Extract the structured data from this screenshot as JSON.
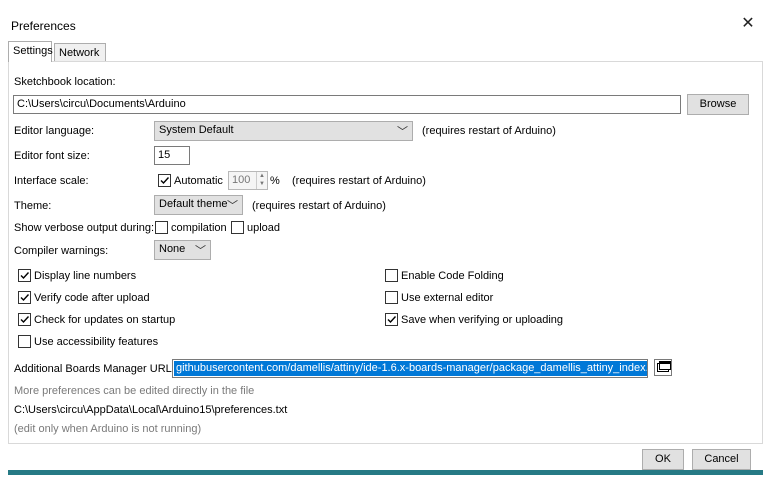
{
  "window": {
    "title": "Preferences",
    "close_icon": "close-icon"
  },
  "tabs": [
    {
      "label": "Settings",
      "active": true
    },
    {
      "label": "Network",
      "active": false
    }
  ],
  "sketchbook": {
    "label": "Sketchbook location:",
    "value": "C:\\Users\\circu\\Documents\\Arduino",
    "browse": "Browse"
  },
  "editor_language": {
    "label": "Editor language:",
    "value": "System Default",
    "note": "(requires restart of Arduino)"
  },
  "font_size": {
    "label": "Editor font size:",
    "value": "15"
  },
  "interface_scale": {
    "label": "Interface scale:",
    "automatic_label": "Automatic",
    "automatic_checked": true,
    "value": "100",
    "unit": "%",
    "note": "(requires restart of Arduino)"
  },
  "theme": {
    "label": "Theme:",
    "value": "Default theme",
    "note": "(requires restart of Arduino)"
  },
  "verbose": {
    "label": "Show verbose output during:",
    "compilation": "compilation",
    "compilation_checked": false,
    "upload": "upload",
    "upload_checked": false
  },
  "compiler_warnings": {
    "label": "Compiler warnings:",
    "value": "None"
  },
  "options_left": [
    {
      "label": "Display line numbers",
      "checked": true
    },
    {
      "label": "Verify code after upload",
      "checked": true
    },
    {
      "label": "Check for updates on startup",
      "checked": true
    },
    {
      "label": "Use accessibility features",
      "checked": false
    }
  ],
  "options_right": [
    {
      "label": "Enable Code Folding",
      "checked": false
    },
    {
      "label": "Use external editor",
      "checked": false
    },
    {
      "label": "Save when verifying or uploading",
      "checked": true
    }
  ],
  "boards_urls": {
    "label": "Additional Boards Manager URLs:",
    "value": "githubusercontent.com/damellis/attiny/ide-1.6.x-boards-manager/package_damellis_attiny_index.json"
  },
  "footer": {
    "more_prefs": "More preferences can be edited directly in the file",
    "path": "C:\\Users\\circu\\AppData\\Local\\Arduino15\\preferences.txt",
    "note": "(edit only when Arduino is not running)"
  },
  "buttons": {
    "ok": "OK",
    "cancel": "Cancel"
  },
  "colors": {
    "selection": "#0078d7",
    "bottom_bar": "#267a85"
  }
}
